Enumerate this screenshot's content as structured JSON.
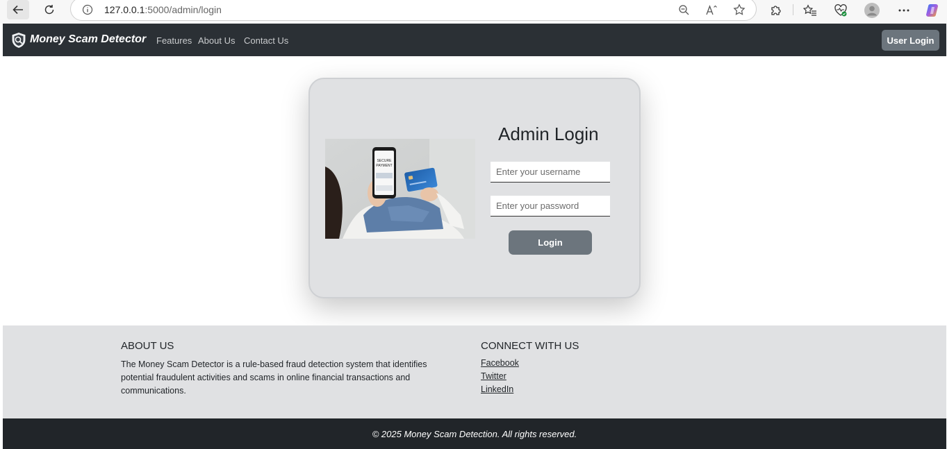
{
  "browser": {
    "url_host": "127.0.0.1",
    "url_rest": ":5000/admin/login",
    "icons": [
      "back-arrow-icon",
      "reload-icon",
      "info-icon",
      "zoom-out-icon",
      "read-aloud-icon",
      "favorite-star-icon",
      "extensions-icon",
      "favorites-icon",
      "browser-essentials-icon",
      "profile-icon",
      "more-icon",
      "copilot-icon"
    ]
  },
  "navbar": {
    "brand": "Money Scam Detector",
    "links": [
      "Features",
      "About Us",
      "Contact Us"
    ],
    "user_login": "User Login"
  },
  "login": {
    "title": "Admin Login",
    "username_placeholder": "Enter your username",
    "password_placeholder": "Enter your password",
    "button": "Login",
    "image_text": "SECURE PAYMENT"
  },
  "footer": {
    "about_heading": "ABOUT US",
    "about_text": "The Money Scam Detector is a rule-based fraud detection system that identifies potential fraudulent activities and scams in online financial transactions and communications.",
    "connect_heading": "CONNECT WITH US",
    "links": [
      "Facebook",
      "Twitter",
      "LinkedIn"
    ],
    "copyright": "© 2025 Money Scam Detection. All rights reserved."
  },
  "colors": {
    "navbar_bg": "#2b3035",
    "button_gray": "#6c757d",
    "card_bg": "#e0e1e3",
    "footer_dark": "#212529"
  }
}
